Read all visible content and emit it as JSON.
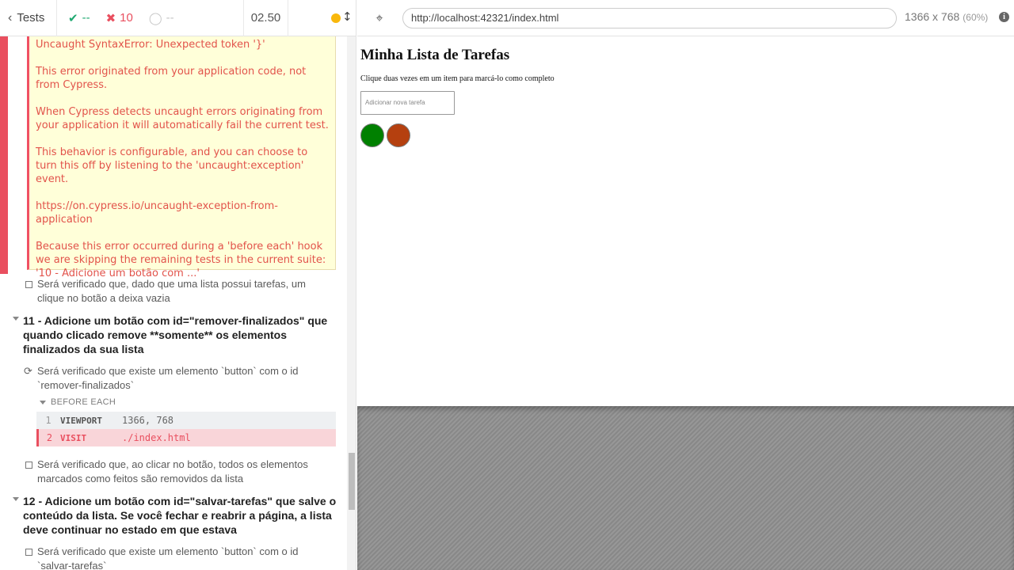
{
  "header": {
    "tests_label": "Tests",
    "passed": "--",
    "failed": "10",
    "pending": "--",
    "duration": "02.50"
  },
  "error": {
    "lines": [
      "Uncaught SyntaxError: Unexpected token '}'",
      "This error originated from your application code, not from Cypress.",
      "When Cypress detects uncaught errors originating from your application it will automatically fail the current test.",
      "This behavior is configurable, and you can choose to turn this off by listening to the 'uncaught:exception' event.",
      "https://on.cypress.io/uncaught-exception-from-application",
      "Because this error occurred during a 'before each' hook we are skipping the remaining tests in the current suite: '10 - Adicione um botão com ...'"
    ]
  },
  "tests": {
    "t10b": "Será verificado que, dado que uma lista possui tarefas, um clique no botão a deixa vazia",
    "suite11": "11 - Adicione um botão com id=\"remover-finalizados\" que quando clicado remove **somente** os elementos finalizados da sua lista",
    "t11a": "Será verificado que existe um elemento `button` com o id `remover-finalizados`",
    "hooks_title": "BEFORE EACH",
    "commands": [
      {
        "n": "1",
        "name": "VIEWPORT",
        "msg": "1366, 768"
      },
      {
        "n": "2",
        "name": "VISIT",
        "msg": "./index.html"
      }
    ],
    "t11b": "Será verificado que, ao clicar no botão, todos os elementos marcados como feitos são removidos da lista",
    "suite12": "12 - Adicione um botão com id=\"salvar-tarefas\" que salve o conteúdo da lista. Se você fechar e reabrir a página, a lista deve continuar no estado em que estava",
    "t12a": "Será verificado que existe um elemento `button` com o id `salvar-tarefas`"
  },
  "aut": {
    "url": "http://localhost:42321/index.html",
    "viewport": "1366 x 768",
    "scale": "(60%)"
  },
  "app": {
    "title": "Minha Lista de Tarefas",
    "instructions": "Clique duas vezes em um item para marcá-lo como completo",
    "input_placeholder": "Adicionar nova tarefa",
    "colors": {
      "button_1": "#008000",
      "button_2": "#b5400f"
    }
  }
}
